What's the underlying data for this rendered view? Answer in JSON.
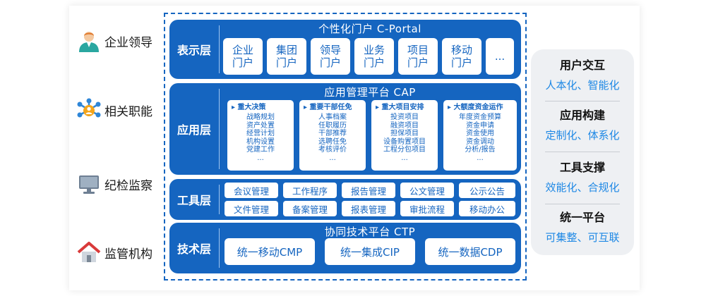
{
  "roles": [
    {
      "label": "企业领导",
      "icon": "business-person-icon"
    },
    {
      "label": "相关职能",
      "icon": "network-nodes-icon"
    },
    {
      "label": "纪检监察",
      "icon": "monitor-icon"
    },
    {
      "label": "监管机构",
      "icon": "house-icon"
    }
  ],
  "layers": {
    "presentation": {
      "label": "表示层",
      "title": "个性化门户 C-Portal",
      "portals": [
        {
          "l1": "企业",
          "l2": "门户"
        },
        {
          "l1": "集团",
          "l2": "门户"
        },
        {
          "l1": "领导",
          "l2": "门户"
        },
        {
          "l1": "业务",
          "l2": "门户"
        },
        {
          "l1": "项目",
          "l2": "门户"
        },
        {
          "l1": "移动",
          "l2": "门户"
        },
        {
          "l1": "",
          "l2": "..."
        }
      ]
    },
    "application": {
      "label": "应用层",
      "title": "应用管理平台 CAP",
      "groups": [
        {
          "title": "重大决策",
          "items": [
            "战略规划",
            "资产处置",
            "经营计划",
            "机构设置",
            "党建工作",
            "..."
          ]
        },
        {
          "title": "重要干部任免",
          "items": [
            "人事档案",
            "任职履历",
            "干部推荐",
            "选聘任免",
            "考核评价",
            "..."
          ]
        },
        {
          "title": "重大项目安排",
          "items": [
            "投资项目",
            "融资项目",
            "担保项目",
            "设备购置项目",
            "工程分包项目",
            "..."
          ]
        },
        {
          "title": "大额度资金运作",
          "items": [
            "年度资金预算",
            "资金申请",
            "资金使用",
            "资金调动",
            "分析/报告",
            "..."
          ]
        }
      ]
    },
    "tool": {
      "label": "工具层",
      "rows": [
        [
          "会议管理",
          "工作程序",
          "报告管理",
          "公文管理",
          "公示公告"
        ],
        [
          "文件管理",
          "备案管理",
          "报表管理",
          "审批流程",
          "移动办公"
        ]
      ]
    },
    "technology": {
      "label": "技术层",
      "title": "协同技术平台 CTP",
      "items": [
        "统一移动CMP",
        "统一集成CIP",
        "统一数据CDP"
      ]
    }
  },
  "features": [
    {
      "title": "用户交互",
      "sub": "人本化、智能化"
    },
    {
      "title": "应用构建",
      "sub": "定制化、体系化"
    },
    {
      "title": "工具支撑",
      "sub": "效能化、合规化"
    },
    {
      "title": "统一平台",
      "sub": "可集整、可互联"
    }
  ],
  "colors": {
    "primary": "#1565c0",
    "accent": "#1e88e5",
    "panel": "#eef0f3"
  }
}
